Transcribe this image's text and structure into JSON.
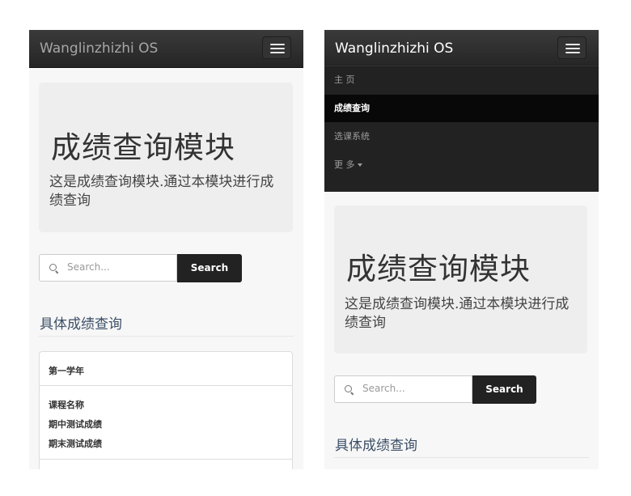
{
  "navbar": {
    "brand": "Wanglinzhizhi OS"
  },
  "menu": {
    "items": [
      "主 页",
      "成绩查询",
      "选课系统",
      "更 多"
    ]
  },
  "jumbotron": {
    "title": "成绩查询模块",
    "lead": "这是成绩查询模块.通过本模块进行成绩查询"
  },
  "search": {
    "placeholder": "Search...",
    "button_label": "Search"
  },
  "section": {
    "title": "具体成绩查询"
  },
  "panel": {
    "heading": "第一学年",
    "lines": [
      "课程名称",
      "期中测试成绩",
      "期末测试成绩"
    ]
  },
  "colors": {
    "navbar_bg": "#252525",
    "menu_active_bg": "#080808",
    "search_button_bg": "#222222",
    "section_title": "#3b4e66"
  }
}
